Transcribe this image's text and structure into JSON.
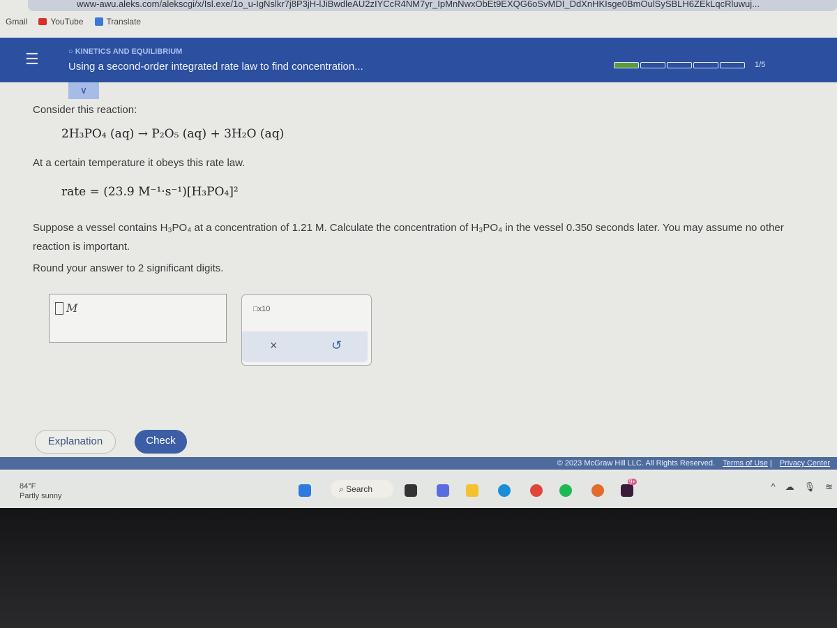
{
  "browser": {
    "url": "www-awu.aleks.com/alekscgi/x/Isl.exe/1o_u-IgNslkr7j8P3jH-lJiBwdleAU2zIYCcR4NM7yr_IpMnNwxObEt9EXQG6oSvMDI_DdXnHKIsge0BmOulSySBLH6ZEkLqcRluwuj...",
    "bookmarks": [
      "Gmail",
      "YouTube",
      "Translate"
    ]
  },
  "header": {
    "topic": "KINETICS AND EQUILIBRIUM",
    "title": "Using a second-order integrated rate law to find concentration...",
    "progress_label": "1/5",
    "progress_fraction": 0.2
  },
  "problem": {
    "intro": "Consider this reaction:",
    "reaction": "2H₃PO₄ (aq) → P₂O₅ (aq) + 3H₂O (aq)",
    "rate_intro": "At a certain temperature it obeys this rate law.",
    "rate_law": "rate = (23.9 M⁻¹·s⁻¹)[H₃PO₄]²",
    "question": "Suppose a vessel contains H₃PO₄ at a concentration of 1.21 M. Calculate the concentration of H₃PO₄ in the vessel 0.350 seconds later. You may assume no other reaction is important.",
    "rounding": "Round your answer to 2 significant digits."
  },
  "answer": {
    "value": "",
    "unit": "M"
  },
  "tools": {
    "sci_notation": "x10",
    "clear": "×",
    "undo": "↺"
  },
  "buttons": {
    "explanation": "Explanation",
    "check": "Check"
  },
  "footer": {
    "copyright": "© 2023 McGraw Hill LLC. All Rights Reserved.",
    "terms": "Terms of Use",
    "privacy": "Privacy Center"
  },
  "taskbar": {
    "temp": "84°F",
    "weather": "Partly sunny",
    "search": "Search",
    "badge": "9+"
  }
}
